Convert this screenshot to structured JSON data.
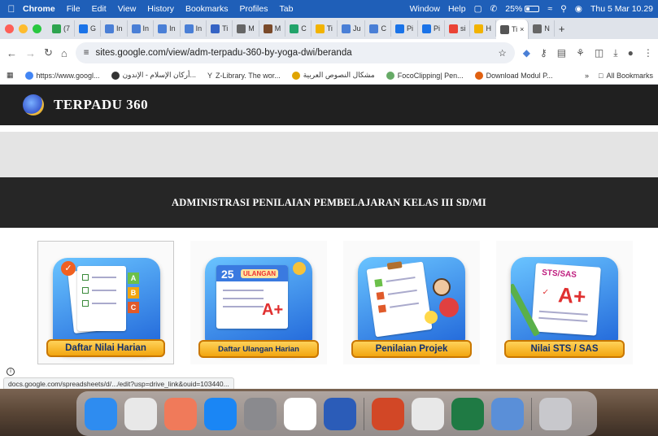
{
  "menubar": {
    "app": "Chrome",
    "items": [
      "File",
      "Edit",
      "View",
      "History",
      "Bookmarks",
      "Profiles",
      "Tab"
    ],
    "right_items": [
      "Window",
      "Help"
    ],
    "battery": "25%",
    "clock": "Thu 5 Mar  10.29"
  },
  "tabs": [
    {
      "label": "(7",
      "color": "#2ea44f"
    },
    {
      "label": "G",
      "color": "#1a73e8"
    },
    {
      "label": "In",
      "color": "#4a7fd6"
    },
    {
      "label": "In",
      "color": "#4a7fd6"
    },
    {
      "label": "In",
      "color": "#4a7fd6"
    },
    {
      "label": "In",
      "color": "#4a7fd6"
    },
    {
      "label": "Ti",
      "color": "#3563c4"
    },
    {
      "label": "M",
      "color": "#666666"
    },
    {
      "label": "M",
      "color": "#7a4a2a"
    },
    {
      "label": "C",
      "color": "#22a36a"
    },
    {
      "label": "Ti",
      "color": "#f2b300"
    },
    {
      "label": "Ju",
      "color": "#4a7fd6"
    },
    {
      "label": "C",
      "color": "#4a7fd6"
    },
    {
      "label": "Pi",
      "color": "#1a73e8"
    },
    {
      "label": "Pi",
      "color": "#1a73e8"
    },
    {
      "label": "si",
      "color": "#ea4335"
    },
    {
      "label": "H",
      "color": "#f2b300"
    },
    {
      "label": "Ti",
      "color": "#555555",
      "active": true
    },
    {
      "label": "N",
      "color": "#666666"
    }
  ],
  "address": {
    "url": "sites.google.com/view/adm-terpadu-360-by-yoga-dwi/beranda"
  },
  "bookmarks": {
    "items": [
      "https://www.googl...",
      "أركان الإسلام - الإندون...",
      "Z-Library. The wor...",
      "مشكال النصوص العربية",
      "FocoClipping| Pen...",
      "Download Modul P..."
    ],
    "more": "»",
    "all": "All Bookmarks"
  },
  "site": {
    "title": "TERPADU 360",
    "banner": "ADMINISTRASI PENILAIAN PEMBELAJARAN KELAS III SD/MI"
  },
  "cards": [
    {
      "label": "Daftar Nilai Harian",
      "icon": "checklist-grades-icon"
    },
    {
      "label": "Daftar Ulangan Harian",
      "icon": "calendar-test-icon",
      "badge": "ULANGAN",
      "day": "25"
    },
    {
      "label": "Penilaian Projek",
      "icon": "project-clipboard-icon"
    },
    {
      "label": "Nilai STS / SAS",
      "icon": "exam-paper-icon",
      "badge": "STS/SAS"
    }
  ],
  "status_bar": {
    "url": "docs.google.com/spreadsheets/d/.../edit?usp=drive_link&ouid=103440..."
  },
  "dock": {
    "apps": [
      {
        "name": "finder-icon",
        "color": "#2e8cf0"
      },
      {
        "name": "calendar-app-icon",
        "color": "#e8e8e8"
      },
      {
        "name": "photos-icon",
        "color": "#f07a5a"
      },
      {
        "name": "app-store-icon",
        "color": "#1a86f5"
      },
      {
        "name": "system-settings-icon",
        "color": "#8a8a8e"
      },
      {
        "name": "chrome-icon",
        "color": "#ffffff"
      },
      {
        "name": "word-icon",
        "color": "#2b5cb8"
      },
      {
        "name": "powerpoint-icon",
        "color": "#d24726"
      },
      {
        "name": "zotero-icon",
        "color": "#e8e8e8"
      },
      {
        "name": "excel-icon",
        "color": "#1f7a44"
      },
      {
        "name": "preview-icon",
        "color": "#5a8fd8"
      },
      {
        "name": "trash-icon",
        "color": "#c8c8cc"
      }
    ]
  }
}
